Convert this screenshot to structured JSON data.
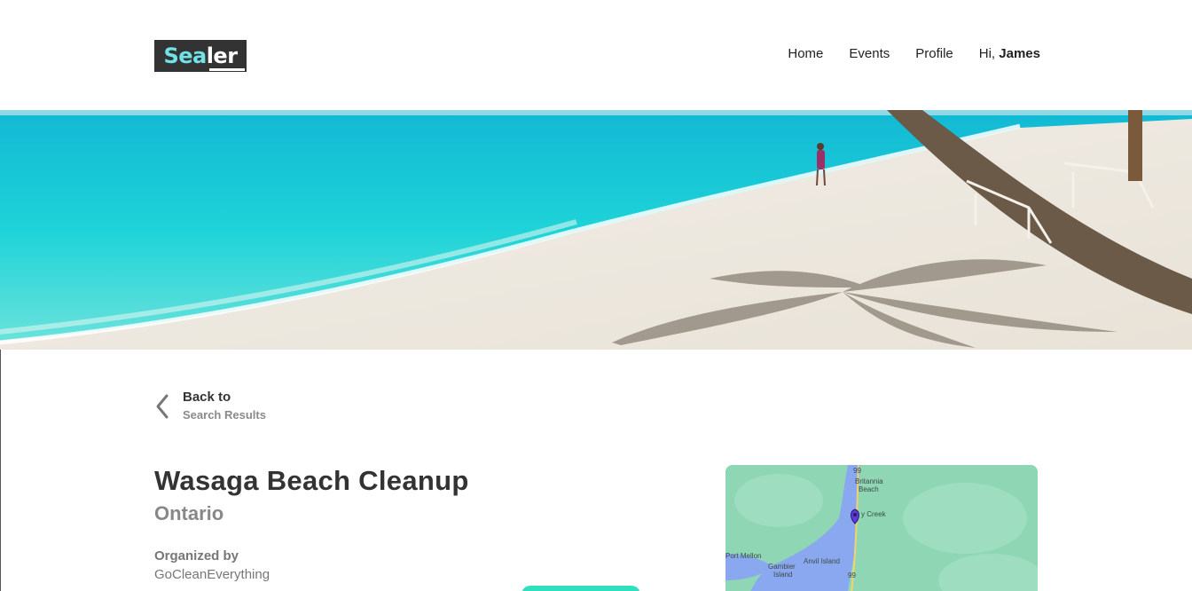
{
  "brand": {
    "logo_part1": "Sea",
    "logo_part2": "ler"
  },
  "nav": {
    "home": "Home",
    "events": "Events",
    "profile": "Profile",
    "greeting": "Hi,",
    "user_name": "James"
  },
  "back_link": {
    "line1": "Back to",
    "line2": "Search Results"
  },
  "event": {
    "title": "Wasaga Beach Cleanup",
    "region": "Ontario",
    "organized_by_label": "Organized by",
    "organizer": "GoCleanEverything"
  },
  "map": {
    "labels": {
      "britannia_1": "Britannia",
      "britannia_2": "Beach",
      "creek": "y Creek",
      "port_mellon": "Port Mellon",
      "gambier_1": "Gambier",
      "gambier_2": "Island",
      "anvil": "Anvil Island",
      "hwy_top": "99",
      "hwy_bottom": "99"
    }
  },
  "colors": {
    "accent": "#2fe0bf",
    "logo_bg": "#333333",
    "logo_sea": "#6fe3e6",
    "water": "#1fc9d6",
    "sand": "#efe9df",
    "map_land": "#8fd6b4",
    "map_water": "#8aa8f0"
  }
}
